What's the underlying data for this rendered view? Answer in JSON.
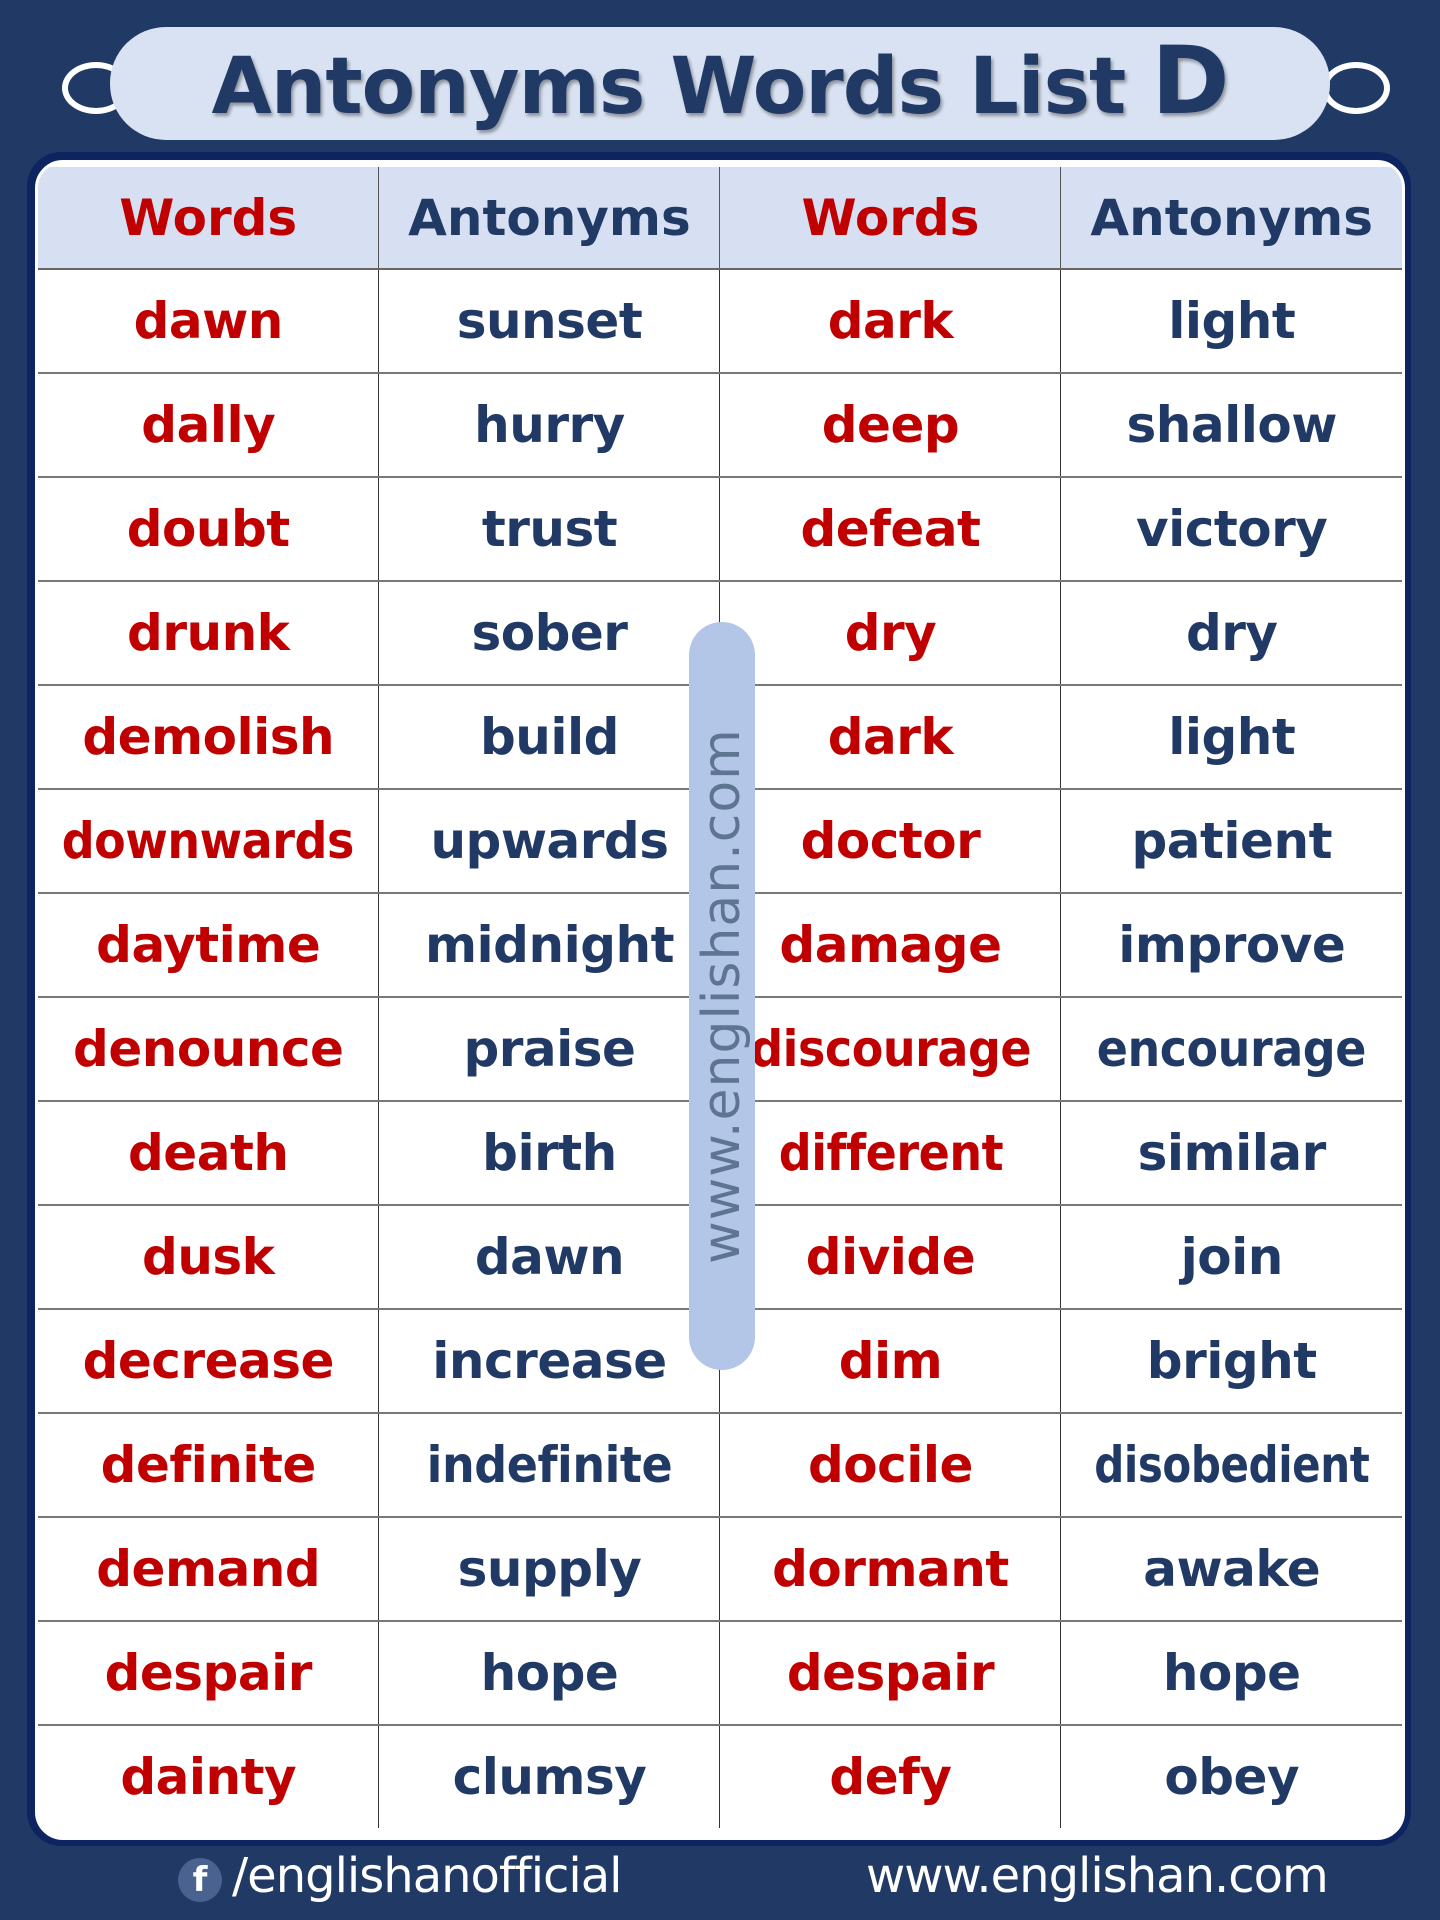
{
  "title": {
    "main": "Antonyms Words  List ",
    "letter": "D"
  },
  "table": {
    "headers": [
      "Words",
      "Antonyms",
      "Words",
      "Antonyms"
    ],
    "rows": [
      [
        "dawn",
        "sunset",
        "dark",
        "light"
      ],
      [
        "dally",
        "hurry",
        "deep",
        "shallow"
      ],
      [
        "doubt",
        "trust",
        "defeat",
        "victory"
      ],
      [
        "drunk",
        "sober",
        "dry",
        "dry"
      ],
      [
        "demolish",
        "build",
        "dark",
        "light"
      ],
      [
        "downwards",
        "upwards",
        "doctor",
        "patient"
      ],
      [
        "daytime",
        "midnight",
        "damage",
        "improve"
      ],
      [
        "denounce",
        "praise",
        "discourage",
        "encourage"
      ],
      [
        "death",
        "birth",
        "different",
        "similar"
      ],
      [
        "dusk",
        "dawn",
        "divide",
        "join"
      ],
      [
        "decrease",
        "increase",
        "dim",
        "bright"
      ],
      [
        "definite",
        "indefinite",
        "docile",
        "disobedient"
      ],
      [
        "demand",
        "supply",
        "dormant",
        "awake"
      ],
      [
        "despair",
        "hope",
        "despair",
        "hope"
      ],
      [
        "dainty",
        "clumsy",
        "defy",
        "obey"
      ]
    ]
  },
  "watermark": "www.englishan.com",
  "footer": {
    "facebook_icon": "f",
    "facebook_handle": "/englishanofficial",
    "website": "www.englishan.com"
  },
  "colors": {
    "background": "#213a65",
    "word": "#c00000",
    "antonym": "#213a65",
    "header_bg": "#d6e0f2",
    "watermark_bg": "#b4c6e7"
  }
}
